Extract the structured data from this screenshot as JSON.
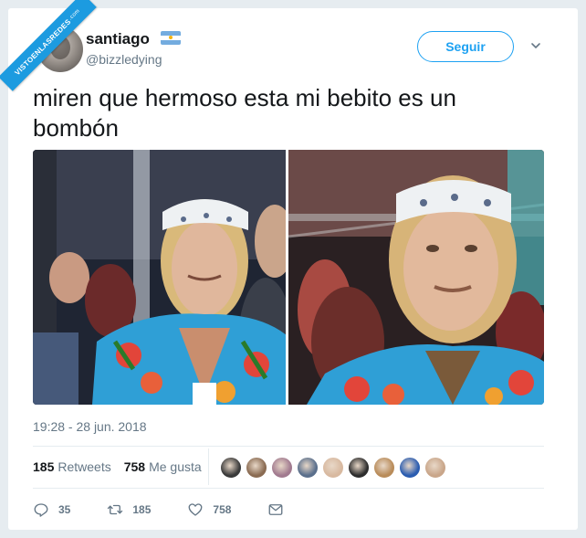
{
  "watermark": {
    "text": "VISTOENLASREDES",
    "suffix": ".com"
  },
  "user": {
    "name": "santiago",
    "handle": "@bizzledying",
    "flag_icon": "argentina-flag-icon"
  },
  "follow_button": {
    "label": "Seguir"
  },
  "tweet": {
    "text": "miren que hermoso esta mi bebito es un bombón",
    "timestamp": "19:28 - 28 jun. 2018"
  },
  "stats": {
    "retweets_count": "185",
    "retweets_label": "Retweets",
    "likes_count": "758",
    "likes_label": "Me gusta"
  },
  "actions": {
    "reply_count": "35",
    "retweet_count": "185",
    "like_count": "758"
  },
  "colors": {
    "accent": "#1da1f2",
    "muted": "#657786",
    "ribbon": "#1c9be0"
  },
  "likers": [
    {
      "color": "#3a3a3a"
    },
    {
      "color": "#8a6b52"
    },
    {
      "color": "#a17a8f"
    },
    {
      "color": "#5a6f8c"
    },
    {
      "color": "#d8b9a0"
    },
    {
      "color": "#2d2d2d"
    },
    {
      "color": "#b98c5a"
    },
    {
      "color": "#2a5cb0"
    },
    {
      "color": "#c9a68a"
    }
  ]
}
